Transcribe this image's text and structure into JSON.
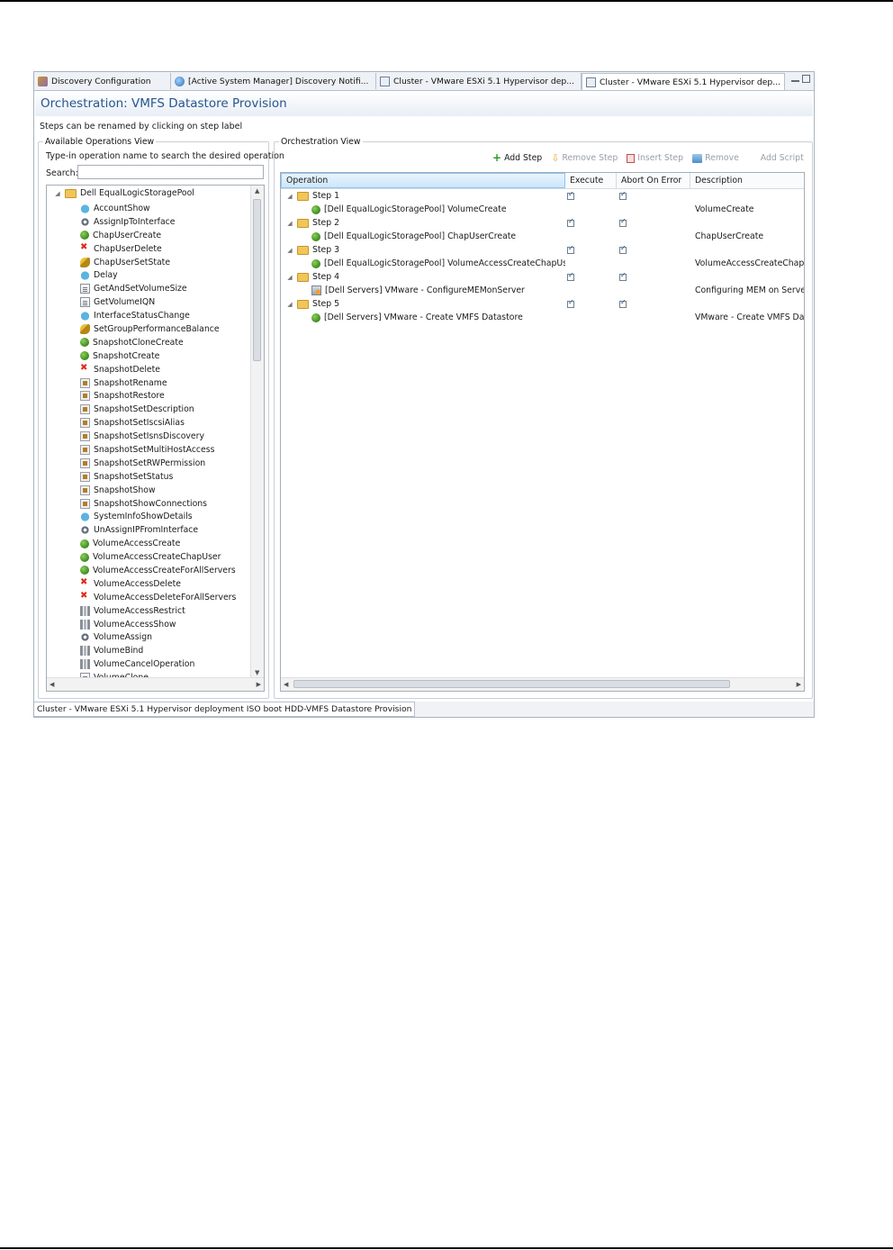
{
  "tabs": [
    {
      "label": "Discovery Configuration",
      "icon": "discovery-config-icon"
    },
    {
      "label": "[Active System Manager] Discovery Notifi...",
      "icon": "globe-icon"
    },
    {
      "label": "Cluster - VMware ESXi 5.1 Hypervisor dep...",
      "icon": "orchestration-icon"
    },
    {
      "label": "Cluster - VMware ESXi 5.1 Hypervisor dep...",
      "icon": "orchestration-icon",
      "close": "☒"
    }
  ],
  "header": {
    "title": "Orchestration: VMFS Datastore Provision"
  },
  "hint": "Steps can be renamed by clicking on step label",
  "left": {
    "legend": "Available Operations View",
    "typein": "Type-in operation name to search the desired operation",
    "search_label": "Search:",
    "search_value": "",
    "root": "Dell EqualLogicStoragePool",
    "items": [
      {
        "label": "AccountShow",
        "icon": "cloud"
      },
      {
        "label": "AssignIpToInterface",
        "icon": "gear"
      },
      {
        "label": "ChapUserCreate",
        "icon": "play"
      },
      {
        "label": "ChapUserDelete",
        "icon": "xmark"
      },
      {
        "label": "ChapUserSetState",
        "icon": "key"
      },
      {
        "label": "Delay",
        "icon": "cloud"
      },
      {
        "label": "GetAndSetVolumeSize",
        "icon": "page"
      },
      {
        "label": "GetVolumeIQN",
        "icon": "page"
      },
      {
        "label": "InterfaceStatusChange",
        "icon": "cloud"
      },
      {
        "label": "SetGroupPerformanceBalance",
        "icon": "key"
      },
      {
        "label": "SnapshotCloneCreate",
        "icon": "play"
      },
      {
        "label": "SnapshotCreate",
        "icon": "play"
      },
      {
        "label": "SnapshotDelete",
        "icon": "xmark"
      },
      {
        "label": "SnapshotRename",
        "icon": "calc"
      },
      {
        "label": "SnapshotRestore",
        "icon": "calc"
      },
      {
        "label": "SnapshotSetDescription",
        "icon": "calc"
      },
      {
        "label": "SnapshotSetIscsiAlias",
        "icon": "calc"
      },
      {
        "label": "SnapshotSetIsnsDiscovery",
        "icon": "calc"
      },
      {
        "label": "SnapshotSetMultiHostAccess",
        "icon": "calc"
      },
      {
        "label": "SnapshotSetRWPermission",
        "icon": "calc"
      },
      {
        "label": "SnapshotSetStatus",
        "icon": "calc"
      },
      {
        "label": "SnapshotShow",
        "icon": "calc"
      },
      {
        "label": "SnapshotShowConnections",
        "icon": "calc"
      },
      {
        "label": "SystemInfoShowDetails",
        "icon": "cloud"
      },
      {
        "label": "UnAssignIPFromInterface",
        "icon": "gear"
      },
      {
        "label": "VolumeAccessCreate",
        "icon": "play"
      },
      {
        "label": "VolumeAccessCreateChapUser",
        "icon": "play"
      },
      {
        "label": "VolumeAccessCreateForAllServers",
        "icon": "play"
      },
      {
        "label": "VolumeAccessDelete",
        "icon": "xmark"
      },
      {
        "label": "VolumeAccessDeleteForAllServers",
        "icon": "xmark"
      },
      {
        "label": "VolumeAccessRestrict",
        "icon": "bars"
      },
      {
        "label": "VolumeAccessShow",
        "icon": "bars"
      },
      {
        "label": "VolumeAssign",
        "icon": "gear"
      },
      {
        "label": "VolumeBind",
        "icon": "bars"
      },
      {
        "label": "VolumeCancelOperation",
        "icon": "bars"
      },
      {
        "label": "VolumeClone",
        "icon": "page"
      }
    ]
  },
  "right": {
    "legend": "Orchestration View",
    "toolbar": {
      "add_step": "Add Step",
      "remove_step": "Remove Step",
      "insert_step": "Insert Step",
      "remove": "Remove",
      "add_script": "Add Script"
    },
    "columns": [
      "Operation",
      "Execute",
      "Abort On Error",
      "Description"
    ],
    "steps": [
      {
        "step": "Step 1",
        "operation": "[Dell EqualLogicStoragePool] VolumeCreate",
        "description": "VolumeCreate",
        "icon": "play"
      },
      {
        "step": "Step 2",
        "operation": "[Dell EqualLogicStoragePool] ChapUserCreate",
        "description": "ChapUserCreate",
        "icon": "play"
      },
      {
        "step": "Step 3",
        "operation": "[Dell EqualLogicStoragePool] VolumeAccessCreateChapUser",
        "description": "VolumeAccessCreateChapUs",
        "icon": "play"
      },
      {
        "step": "Step 4",
        "operation": "[Dell Servers] VMware - ConfigureMEMonServer",
        "description": "Configuring MEM on Server",
        "icon": "mem"
      },
      {
        "step": "Step 5",
        "operation": "[Dell Servers] VMware - Create VMFS Datastore",
        "description": "VMware - Create VMFS Data",
        "icon": "play"
      }
    ]
  },
  "bottom_tab": "Cluster - VMware ESXi 5.1 Hypervisor deployment ISO boot HDD-VMFS Datastore Provision"
}
